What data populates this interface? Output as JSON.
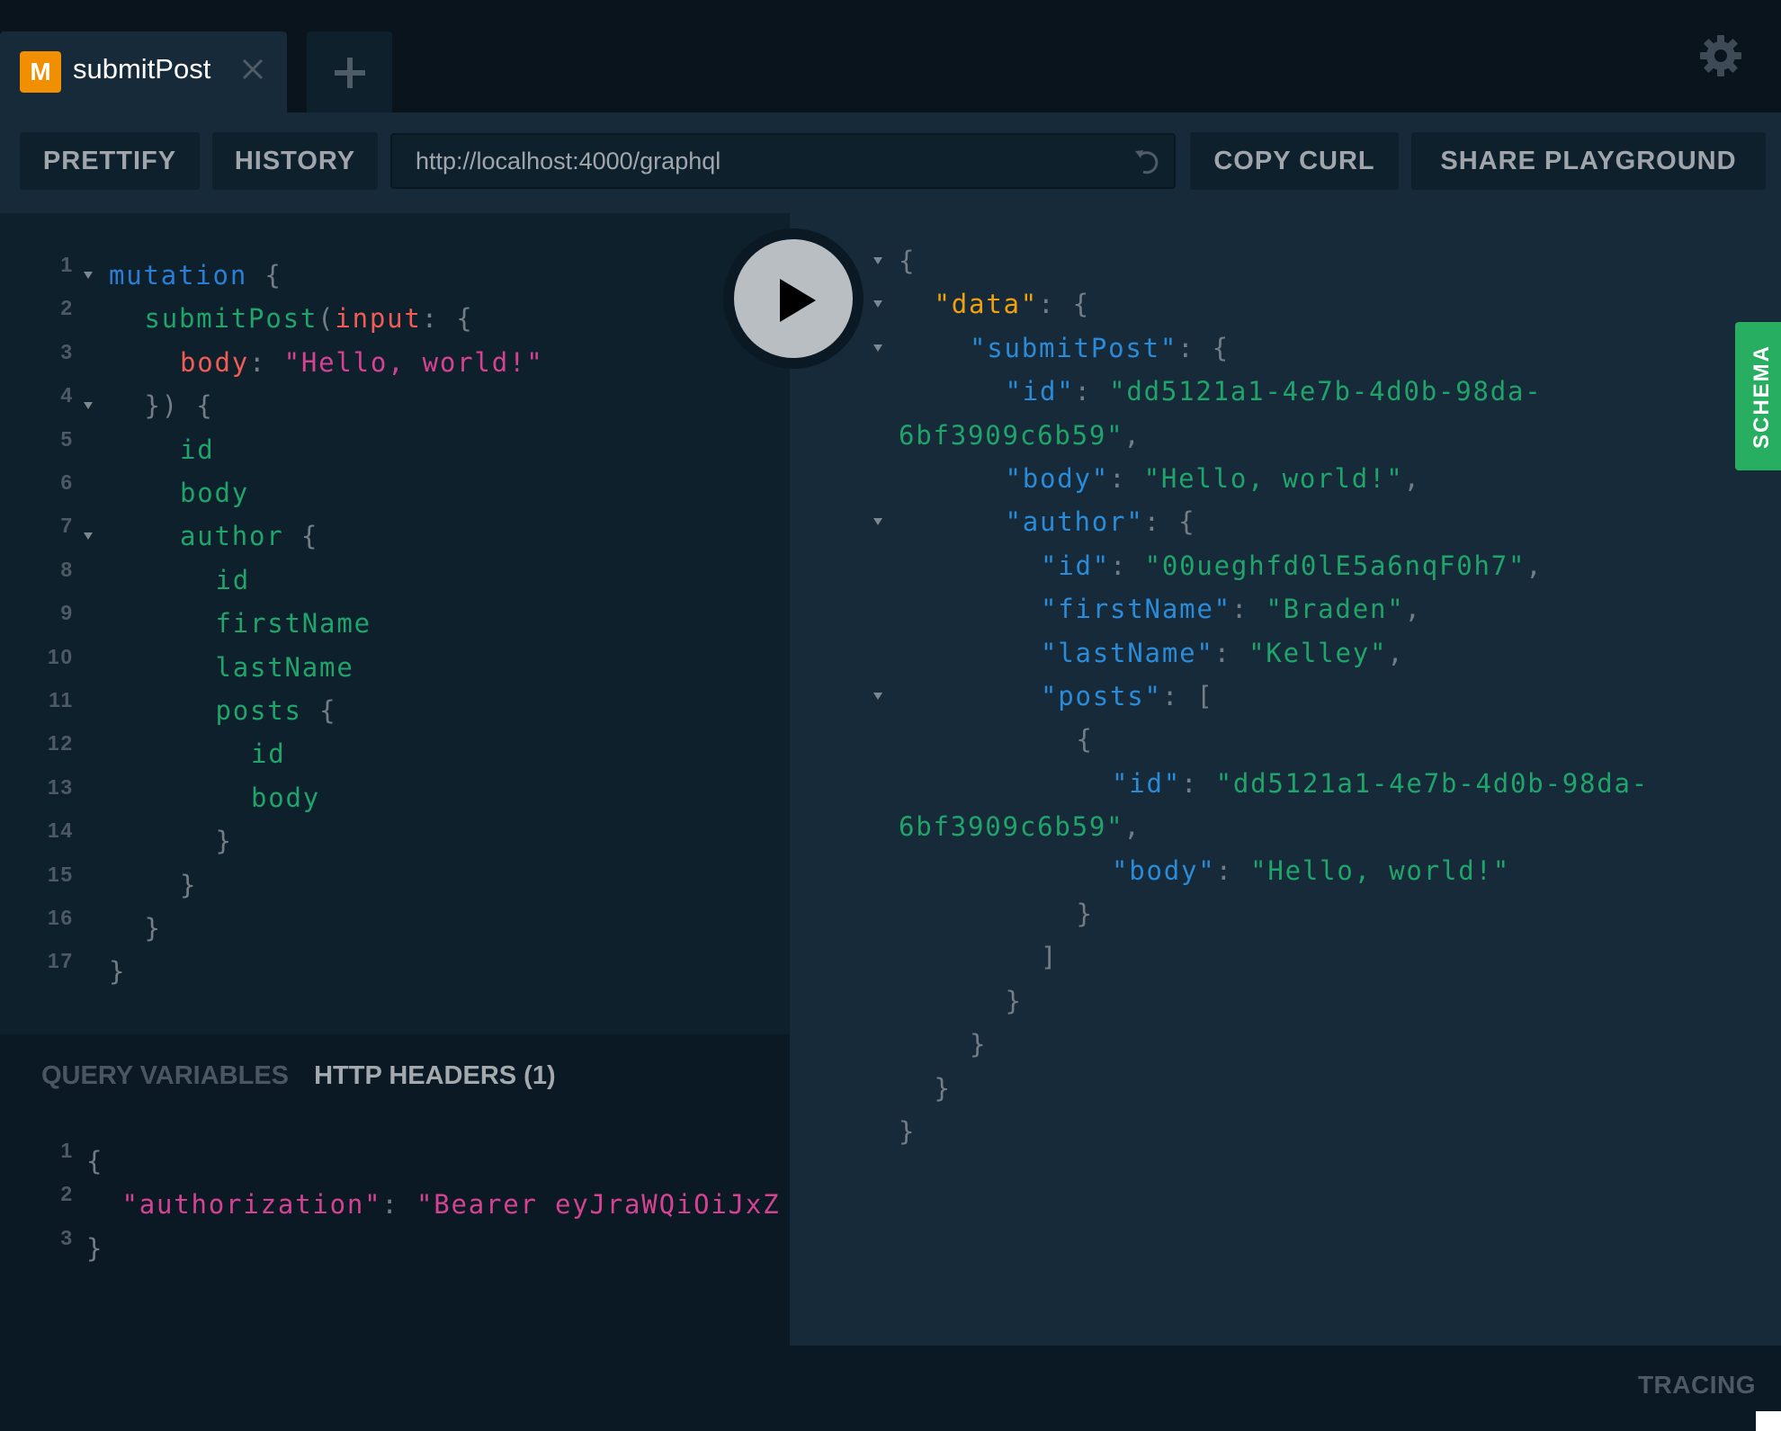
{
  "tabs": [
    {
      "badge": "M",
      "title": "submitPost",
      "active": true
    }
  ],
  "icons": {
    "close": "close-icon",
    "new_tab": "plus-icon",
    "settings": "gear-icon",
    "reload": "reload-icon",
    "run": "play-icon"
  },
  "toolbar": {
    "prettify_label": "PRETTIFY",
    "history_label": "HISTORY",
    "endpoint_url": "http://localhost:4000/graphql",
    "copy_curl_label": "COPY CURL",
    "share_label": "SHARE PLAYGROUND"
  },
  "editor": {
    "lines": [
      {
        "n": "1",
        "fold": true,
        "indent": 0,
        "tokens": [
          [
            "kw",
            "mutation"
          ],
          [
            "punc",
            " {"
          ]
        ]
      },
      {
        "n": "2",
        "fold": false,
        "indent": 1,
        "tokens": [
          [
            "field",
            "submitPost"
          ],
          [
            "punc",
            "("
          ],
          [
            "arg",
            "input"
          ],
          [
            "punc",
            ": {"
          ]
        ]
      },
      {
        "n": "3",
        "fold": false,
        "indent": 2,
        "tokens": [
          [
            "arg",
            "body"
          ],
          [
            "punc",
            ": "
          ],
          [
            "str",
            "\"Hello, world!\""
          ]
        ]
      },
      {
        "n": "4",
        "fold": true,
        "indent": 1,
        "tokens": [
          [
            "punc",
            "}) {"
          ]
        ]
      },
      {
        "n": "5",
        "fold": false,
        "indent": 2,
        "tokens": [
          [
            "field",
            "id"
          ]
        ]
      },
      {
        "n": "6",
        "fold": false,
        "indent": 2,
        "tokens": [
          [
            "field",
            "body"
          ]
        ]
      },
      {
        "n": "7",
        "fold": true,
        "indent": 2,
        "tokens": [
          [
            "field",
            "author"
          ],
          [
            "punc",
            " {"
          ]
        ]
      },
      {
        "n": "8",
        "fold": false,
        "indent": 3,
        "tokens": [
          [
            "field",
            "id"
          ]
        ]
      },
      {
        "n": "9",
        "fold": false,
        "indent": 3,
        "tokens": [
          [
            "field",
            "firstName"
          ]
        ]
      },
      {
        "n": "10",
        "fold": false,
        "indent": 3,
        "tokens": [
          [
            "field",
            "lastName"
          ]
        ]
      },
      {
        "n": "11",
        "fold": false,
        "indent": 3,
        "tokens": [
          [
            "field",
            "posts"
          ],
          [
            "punc",
            " {"
          ]
        ]
      },
      {
        "n": "12",
        "fold": false,
        "indent": 4,
        "tokens": [
          [
            "field",
            "id"
          ]
        ]
      },
      {
        "n": "13",
        "fold": false,
        "indent": 4,
        "tokens": [
          [
            "field",
            "body"
          ]
        ]
      },
      {
        "n": "14",
        "fold": false,
        "indent": 3,
        "tokens": [
          [
            "punc",
            "}"
          ]
        ]
      },
      {
        "n": "15",
        "fold": false,
        "indent": 2,
        "tokens": [
          [
            "punc",
            "}"
          ]
        ]
      },
      {
        "n": "16",
        "fold": false,
        "indent": 1,
        "tokens": [
          [
            "punc",
            "}"
          ]
        ]
      },
      {
        "n": "17",
        "fold": false,
        "indent": 0,
        "tokens": [
          [
            "punc",
            "}"
          ]
        ]
      }
    ]
  },
  "bottom_panel": {
    "tab_query_variables": "QUERY VARIABLES",
    "tab_http_headers": "HTTP HEADERS (1)",
    "active_tab": "HTTP HEADERS (1)",
    "lines": [
      {
        "n": "1",
        "indent": 0,
        "tokens": [
          [
            "punc",
            "{"
          ]
        ]
      },
      {
        "n": "2",
        "indent": 1,
        "tokens": [
          [
            "str",
            "\"authorization\""
          ],
          [
            "punc",
            ": "
          ],
          [
            "str",
            "\"Bearer eyJraWQiOiJxZ"
          ]
        ]
      },
      {
        "n": "3",
        "indent": 0,
        "tokens": [
          [
            "punc",
            "}"
          ]
        ]
      }
    ]
  },
  "results": {
    "lines": [
      {
        "fold": true,
        "indent": 0,
        "tokens": [
          [
            "punc",
            "{"
          ]
        ]
      },
      {
        "fold": true,
        "indent": 1,
        "tokens": [
          [
            "data",
            "\"data\""
          ],
          [
            "punc",
            ": {"
          ]
        ]
      },
      {
        "fold": true,
        "indent": 2,
        "tokens": [
          [
            "key",
            "\"submitPost\""
          ],
          [
            "punc",
            ": {"
          ]
        ]
      },
      {
        "fold": false,
        "indent": 3,
        "tokens": [
          [
            "key",
            "\"id\""
          ],
          [
            "punc",
            ": "
          ],
          [
            "val",
            "\"dd5121a1-4e7b-4d0b-98da-"
          ]
        ]
      },
      {
        "fold": false,
        "indent": 0,
        "tokens": [
          [
            "val",
            "6bf3909c6b59\""
          ],
          [
            "punc",
            ","
          ]
        ]
      },
      {
        "fold": false,
        "indent": 3,
        "tokens": [
          [
            "key",
            "\"body\""
          ],
          [
            "punc",
            ": "
          ],
          [
            "val",
            "\"Hello, world!\""
          ],
          [
            "punc",
            ","
          ]
        ]
      },
      {
        "fold": true,
        "indent": 3,
        "tokens": [
          [
            "key",
            "\"author\""
          ],
          [
            "punc",
            ": {"
          ]
        ]
      },
      {
        "fold": false,
        "indent": 4,
        "tokens": [
          [
            "key",
            "\"id\""
          ],
          [
            "punc",
            ": "
          ],
          [
            "val",
            "\"00ueghfd0lE5a6nqF0h7\""
          ],
          [
            "punc",
            ","
          ]
        ]
      },
      {
        "fold": false,
        "indent": 4,
        "tokens": [
          [
            "key",
            "\"firstName\""
          ],
          [
            "punc",
            ": "
          ],
          [
            "val",
            "\"Braden\""
          ],
          [
            "punc",
            ","
          ]
        ]
      },
      {
        "fold": false,
        "indent": 4,
        "tokens": [
          [
            "key",
            "\"lastName\""
          ],
          [
            "punc",
            ": "
          ],
          [
            "val",
            "\"Kelley\""
          ],
          [
            "punc",
            ","
          ]
        ]
      },
      {
        "fold": true,
        "indent": 4,
        "tokens": [
          [
            "key",
            "\"posts\""
          ],
          [
            "punc",
            ": ["
          ]
        ]
      },
      {
        "fold": false,
        "indent": 5,
        "tokens": [
          [
            "punc",
            "{"
          ]
        ]
      },
      {
        "fold": false,
        "indent": 6,
        "tokens": [
          [
            "key",
            "\"id\""
          ],
          [
            "punc",
            ": "
          ],
          [
            "val",
            "\"dd5121a1-4e7b-4d0b-98da-"
          ]
        ]
      },
      {
        "fold": false,
        "indent": 0,
        "tokens": [
          [
            "val",
            "6bf3909c6b59\""
          ],
          [
            "punc",
            ","
          ]
        ]
      },
      {
        "fold": false,
        "indent": 6,
        "tokens": [
          [
            "key",
            "\"body\""
          ],
          [
            "punc",
            ": "
          ],
          [
            "val",
            "\"Hello, world!\""
          ]
        ]
      },
      {
        "fold": false,
        "indent": 5,
        "tokens": [
          [
            "punc",
            "}"
          ]
        ]
      },
      {
        "fold": false,
        "indent": 4,
        "tokens": [
          [
            "punc",
            "]"
          ]
        ]
      },
      {
        "fold": false,
        "indent": 3,
        "tokens": [
          [
            "punc",
            "}"
          ]
        ]
      },
      {
        "fold": false,
        "indent": 2,
        "tokens": [
          [
            "punc",
            "}"
          ]
        ]
      },
      {
        "fold": false,
        "indent": 1,
        "tokens": [
          [
            "punc",
            "}"
          ]
        ]
      },
      {
        "fold": false,
        "indent": 0,
        "tokens": [
          [
            "punc",
            "}"
          ]
        ]
      }
    ]
  },
  "side_tabs": {
    "schema_label": "SCHEMA"
  },
  "footer": {
    "tracing_label": "TRACING"
  },
  "colors": {
    "badge_mutation": "#f18f01",
    "schema_tab": "#27ae60",
    "keyword": "#2a7ed3",
    "field": "#1fa46a",
    "argument": "#f25c54",
    "string": "#d64292",
    "json_key": "#2a8bd8",
    "json_data_key": "#f1a10e"
  }
}
